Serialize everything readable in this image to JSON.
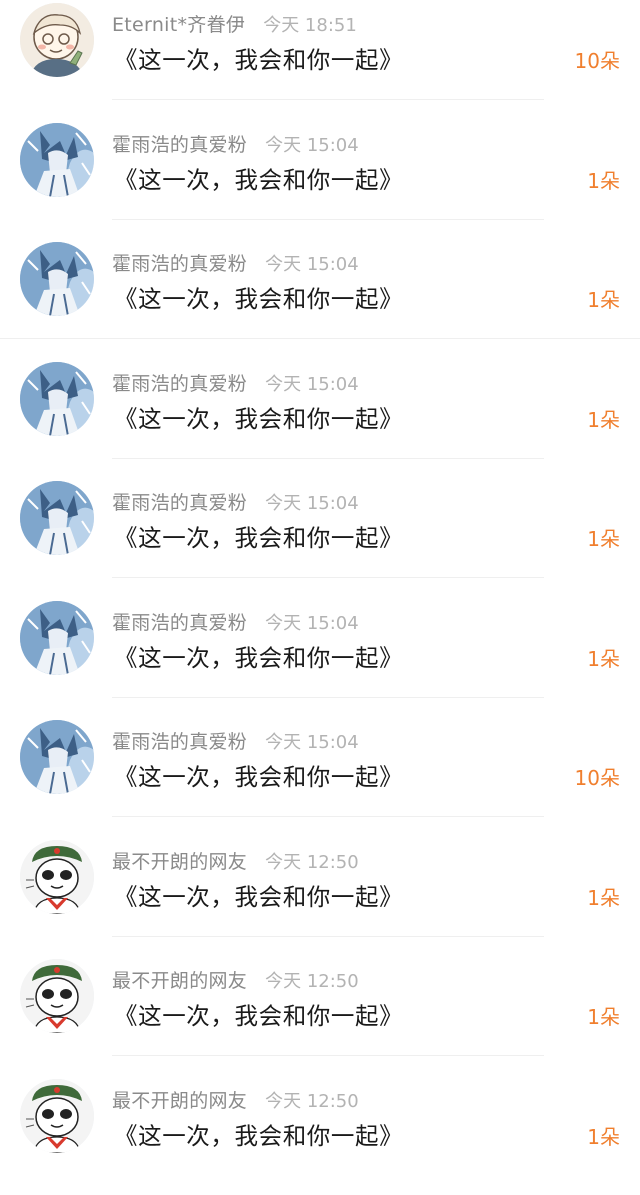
{
  "colors": {
    "username": "#8a8a8a",
    "time": "#b3b3b3",
    "message": "#1a1a1a",
    "count": "#f07f2e",
    "divider": "#efefef"
  },
  "items": [
    {
      "avatar": "cartoon-child-avatar",
      "username": "Eternit*齐眷伊",
      "time": "今天 18:51",
      "message": "《这一次，我会和你一起》",
      "count": "10朵"
    },
    {
      "avatar": "anime-boy-avatar",
      "username": "霍雨浩的真爱粉",
      "time": "今天 15:04",
      "message": "《这一次，我会和你一起》",
      "count": "1朵"
    },
    {
      "avatar": "anime-boy-avatar",
      "username": "霍雨浩的真爱粉",
      "time": "今天 15:04",
      "message": "《这一次，我会和你一起》",
      "count": "1朵"
    },
    {
      "avatar": "anime-boy-avatar",
      "username": "霍雨浩的真爱粉",
      "time": "今天 15:04",
      "message": "《这一次，我会和你一起》",
      "count": "1朵"
    },
    {
      "avatar": "anime-boy-avatar",
      "username": "霍雨浩的真爱粉",
      "time": "今天 15:04",
      "message": "《这一次，我会和你一起》",
      "count": "1朵"
    },
    {
      "avatar": "anime-boy-avatar",
      "username": "霍雨浩的真爱粉",
      "time": "今天 15:04",
      "message": "《这一次，我会和你一起》",
      "count": "1朵"
    },
    {
      "avatar": "anime-boy-avatar",
      "username": "霍雨浩的真爱粉",
      "time": "今天 15:04",
      "message": "《这一次，我会和你一起》",
      "count": "10朵"
    },
    {
      "avatar": "panda-meme-avatar",
      "username": "最不开朗的网友",
      "time": "今天 12:50",
      "message": "《这一次，我会和你一起》",
      "count": "1朵"
    },
    {
      "avatar": "panda-meme-avatar",
      "username": "最不开朗的网友",
      "time": "今天 12:50",
      "message": "《这一次，我会和你一起》",
      "count": "1朵"
    },
    {
      "avatar": "panda-meme-avatar",
      "username": "最不开朗的网友",
      "time": "今天 12:50",
      "message": "《这一次，我会和你一起》",
      "count": "1朵"
    }
  ]
}
